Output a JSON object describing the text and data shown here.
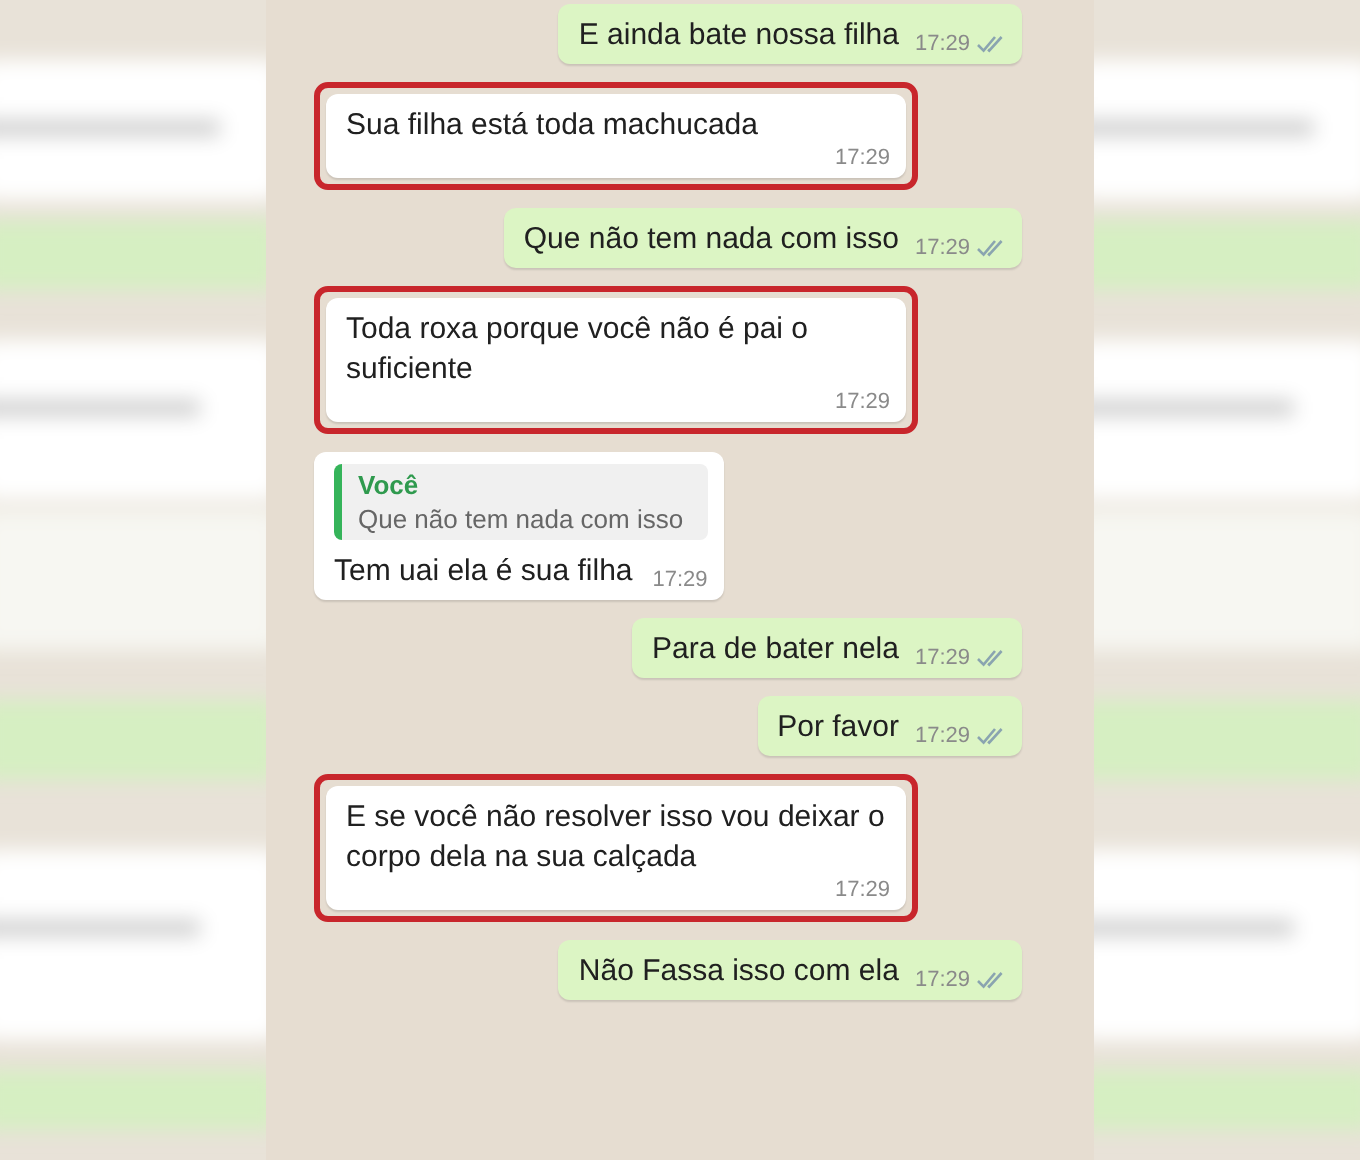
{
  "messages": [
    {
      "kind": "sent",
      "text": "E ainda bate nossa filha",
      "time": "17:29",
      "highlighted": false
    },
    {
      "kind": "received",
      "text": "Sua filha está toda machucada",
      "time": "17:29",
      "highlighted": true
    },
    {
      "kind": "sent",
      "text": "Que não tem nada com isso",
      "time": "17:29",
      "highlighted": false
    },
    {
      "kind": "received",
      "text": "Toda roxa porque você não é pai o suficiente",
      "time": "17:29",
      "highlighted": true
    },
    {
      "kind": "received",
      "quote": {
        "author": "Você",
        "text": "Que não tem nada com isso"
      },
      "text": "Tem uai ela é sua filha",
      "time": "17:29",
      "highlighted": false
    },
    {
      "kind": "sent",
      "text": "Para de bater nela",
      "time": "17:29",
      "highlighted": false
    },
    {
      "kind": "sent",
      "text": "Por favor",
      "time": "17:29",
      "highlighted": false
    },
    {
      "kind": "received",
      "text": "E se você não resolver isso vou deixar o corpo dela na sua calçada",
      "time": "17:29",
      "highlighted": true
    },
    {
      "kind": "sent",
      "text": "Não Fassa isso com ela",
      "time": "17:29",
      "highlighted": false
    }
  ]
}
